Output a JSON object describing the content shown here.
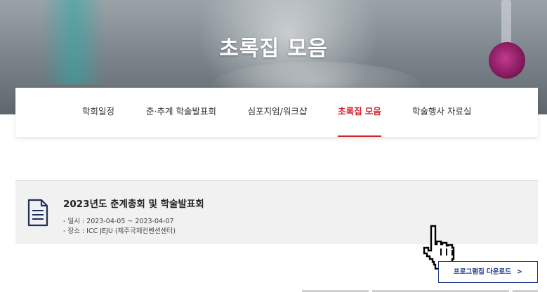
{
  "hero": {
    "title": "초록집 모음"
  },
  "tabs": [
    {
      "label": "학회일정",
      "active": false
    },
    {
      "label": "춘·추계 학술발표회",
      "active": false
    },
    {
      "label": "심포지엄/워크샵",
      "active": false
    },
    {
      "label": "초록집 모음",
      "active": true
    },
    {
      "label": "학술행사 자료실",
      "active": false
    }
  ],
  "event": {
    "icon": "document-icon",
    "title": "2023년도 춘계총회 및 학술발표회",
    "date_line": "-  일시 : 2023-04-05 ~ 2023-04-07",
    "place_line": "-  장소 : ICC JEJU (제주국제컨벤션센터)"
  },
  "download": {
    "label": "프로그램집 다운로드",
    "chevron": ">"
  },
  "cursor": {
    "icon": "hand-pointer-icon"
  },
  "colors": {
    "accent": "#d2232a",
    "button_border": "#203a8a",
    "event_bg": "#f1f1f1"
  }
}
